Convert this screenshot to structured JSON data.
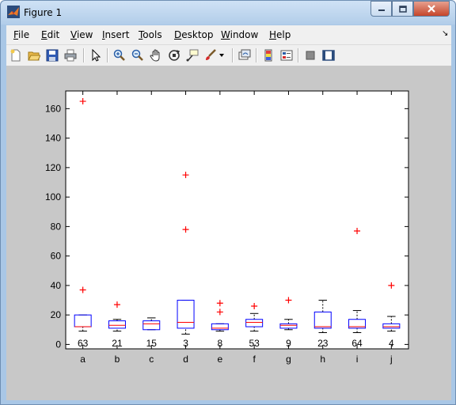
{
  "window": {
    "title": "Figure 1"
  },
  "menu": [
    {
      "pre": "",
      "u": "F",
      "post": "ile"
    },
    {
      "pre": "",
      "u": "E",
      "post": "dit"
    },
    {
      "pre": "",
      "u": "V",
      "post": "iew"
    },
    {
      "pre": "",
      "u": "I",
      "post": "nsert"
    },
    {
      "pre": "",
      "u": "T",
      "post": "ools"
    },
    {
      "pre": "",
      "u": "D",
      "post": "esktop"
    },
    {
      "pre": "",
      "u": "W",
      "post": "indow"
    },
    {
      "pre": "",
      "u": "H",
      "post": "elp"
    }
  ],
  "toolbar_icons": [
    "new-figure-icon",
    "open-file-icon",
    "save-icon",
    "print-icon",
    "edit-plot-arrow-icon",
    "zoom-in-icon",
    "zoom-out-icon",
    "pan-hand-icon",
    "rotate-3d-icon",
    "data-cursor-icon",
    "brush-icon",
    "link-plot-icon",
    "colorbar-icon",
    "legend-icon",
    "hide-plot-tools-icon",
    "show-plot-tools-icon"
  ],
  "colors": {
    "box": "#0000ff",
    "median": "#ff0000",
    "outlier": "#ff0000",
    "whisker": "#000000",
    "axes_bg": "#ffffff",
    "figure_bg": "#c8c8c8"
  },
  "chart_data": {
    "type": "box",
    "title": "",
    "xlabel": "",
    "ylabel": "",
    "ylim": [
      -3,
      172
    ],
    "yticks": [
      0,
      20,
      40,
      60,
      80,
      100,
      120,
      140,
      160
    ],
    "categories": [
      "a",
      "b",
      "c",
      "d",
      "e",
      "f",
      "g",
      "h",
      "i",
      "j"
    ],
    "counts": [
      "63",
      "21",
      "15",
      "3",
      "8",
      "53",
      "9",
      "23",
      "64",
      "4"
    ],
    "boxes": [
      {
        "whislo": 9,
        "q1": 12,
        "med": 12,
        "q3": 20,
        "whishi": 20,
        "outliers": [
          37,
          165
        ]
      },
      {
        "whislo": 9,
        "q1": 11,
        "med": 13,
        "q3": 16,
        "whishi": 17,
        "outliers": [
          27
        ]
      },
      {
        "whislo": 10,
        "q1": 10,
        "med": 14,
        "q3": 16,
        "whishi": 18,
        "outliers": []
      },
      {
        "whislo": 7,
        "q1": 11,
        "med": 15,
        "q3": 30,
        "whishi": 30,
        "outliers": [
          78,
          115
        ]
      },
      {
        "whislo": 9,
        "q1": 10,
        "med": 11,
        "q3": 14,
        "whishi": 14,
        "outliers": [
          22,
          28
        ]
      },
      {
        "whislo": 9,
        "q1": 12,
        "med": 15,
        "q3": 17,
        "whishi": 21,
        "outliers": [
          26
        ]
      },
      {
        "whislo": 10,
        "q1": 11,
        "med": 13,
        "q3": 14,
        "whishi": 17,
        "outliers": [
          30
        ]
      },
      {
        "whislo": 8,
        "q1": 11,
        "med": 12,
        "q3": 22,
        "whishi": 30,
        "outliers": []
      },
      {
        "whislo": 8,
        "q1": 11,
        "med": 12,
        "q3": 17,
        "whishi": 23,
        "outliers": [
          77
        ]
      },
      {
        "whislo": 9,
        "q1": 11,
        "med": 12,
        "q3": 14,
        "whishi": 19,
        "outliers": [
          40
        ]
      }
    ]
  }
}
